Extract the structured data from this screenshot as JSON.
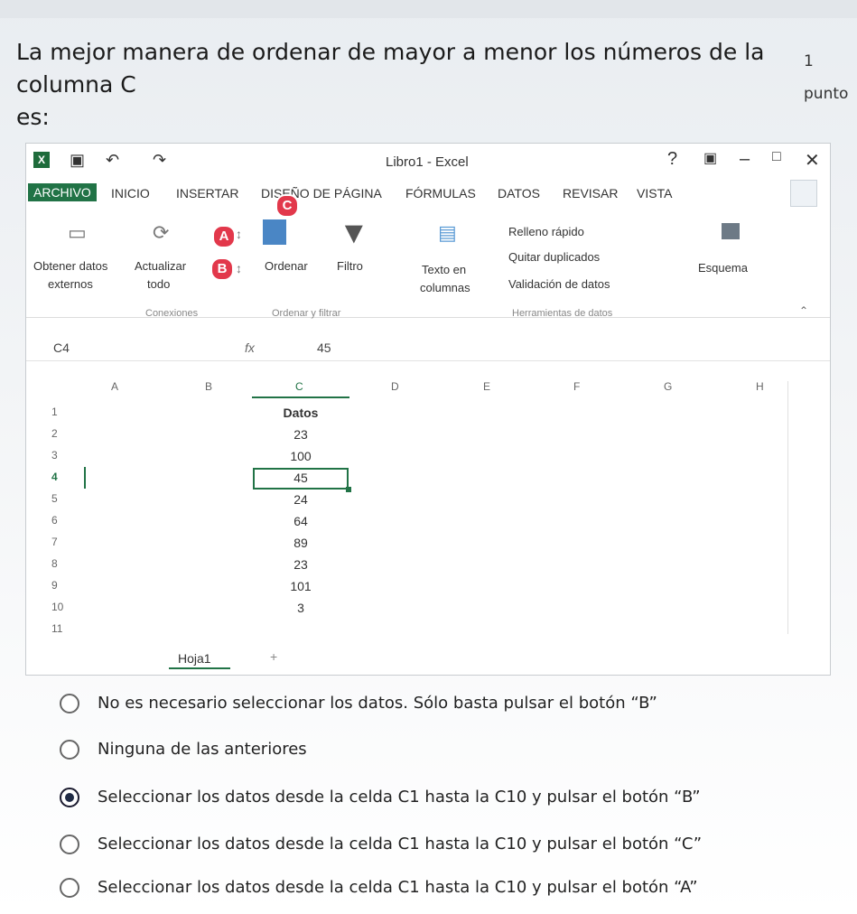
{
  "question": {
    "text_line1": "La mejor manera de ordenar de mayor a menor los números de la columna C",
    "text_line2": "es:",
    "points": "1 punto"
  },
  "excel": {
    "window_title": "Libro1 - Excel",
    "help": "?",
    "tabs": [
      "ARCHIVO",
      "INICIO",
      "INSERTAR",
      "DISEÑO DE PÁGINA",
      "FÓRMULAS",
      "DATOS",
      "REVISAR",
      "VISTA"
    ],
    "ribbon": {
      "obtener_datos": "Obtener datos",
      "externos": "externos",
      "actualizar": "Actualizar",
      "todo": "todo",
      "ordenar": "Ordenar",
      "filtro": "Filtro",
      "texto_en": "Texto en",
      "columnas": "columnas",
      "relleno_rapido": "Relleno rápido",
      "quitar_duplicados": "Quitar duplicados",
      "validacion": "Validación de datos",
      "esquema": "Esquema",
      "group_conexiones": "Conexiones",
      "group_ordenar": "Ordenar y filtrar",
      "group_herramientas": "Herramientas de datos",
      "badge_a": "A",
      "badge_b": "B",
      "badge_c": "C"
    },
    "formula_bar": {
      "name_box": "C4",
      "fx": "fx",
      "value": "45"
    },
    "columns": [
      "A",
      "B",
      "C",
      "D",
      "E",
      "F",
      "G",
      "H"
    ],
    "rows": [
      {
        "n": "1",
        "c": "Datos"
      },
      {
        "n": "2",
        "c": "23"
      },
      {
        "n": "3",
        "c": "100"
      },
      {
        "n": "4",
        "c": "45"
      },
      {
        "n": "5",
        "c": "24"
      },
      {
        "n": "6",
        "c": "64"
      },
      {
        "n": "7",
        "c": "89"
      },
      {
        "n": "8",
        "c": "23"
      },
      {
        "n": "9",
        "c": "101"
      },
      {
        "n": "10",
        "c": "3"
      },
      {
        "n": "11",
        "c": ""
      }
    ],
    "sheet_tab": "Hoja1",
    "add_sheet": "+"
  },
  "options": [
    {
      "label": "No es necesario seleccionar los datos. Sólo basta pulsar el botón “B”",
      "checked": false
    },
    {
      "label": "Ninguna de las anteriores",
      "checked": false
    },
    {
      "label": "Seleccionar los datos desde la celda C1 hasta la C10 y pulsar el botón “B”",
      "checked": true
    },
    {
      "label": "Seleccionar los datos desde la celda C1 hasta la C10 y pulsar el botón “C”",
      "checked": false
    },
    {
      "label": "Seleccionar los datos desde la celda C1 hasta la C10 y pulsar el botón “A”",
      "checked": false
    }
  ]
}
